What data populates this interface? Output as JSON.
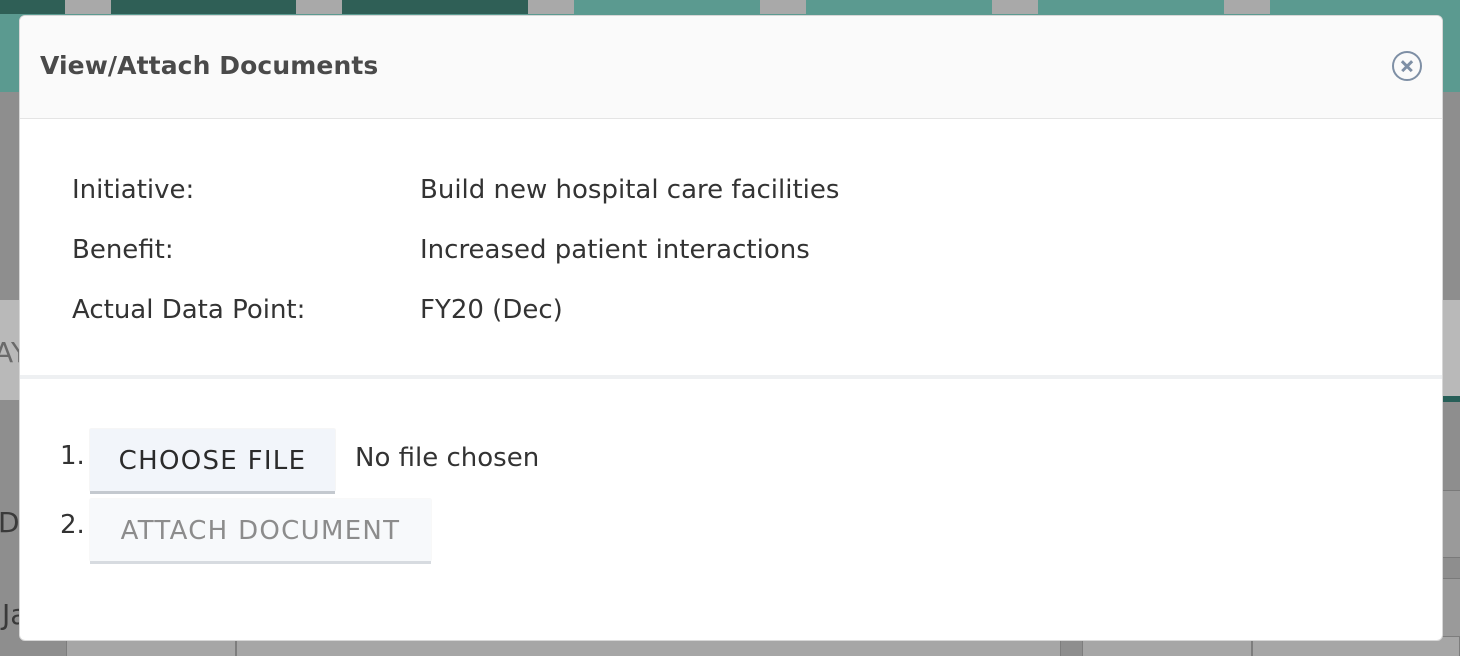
{
  "modal": {
    "title": "View/Attach Documents",
    "close_icon": "close-circle-icon"
  },
  "info": {
    "rows": [
      {
        "label": "Initiative:",
        "value": "Build new hospital care facilities"
      },
      {
        "label": "Benefit:",
        "value": "Increased patient interactions"
      },
      {
        "label": "Actual Data Point:",
        "value": "FY20 (Dec)"
      }
    ]
  },
  "upload": {
    "step1_number": "1.",
    "choose_file_label": "CHOOSE FILE",
    "file_status": "No file chosen",
    "step2_number": "2.",
    "attach_label": "ATTACH DOCUMENT"
  },
  "background": {
    "peek_left_1": "AY",
    "peek_left_2": "D",
    "peek_left_3": "Ja"
  },
  "colors": {
    "header_accent": "#5b9a90",
    "close_icon": "#7e8fa5",
    "disabled_text": "#8c8c8c"
  }
}
